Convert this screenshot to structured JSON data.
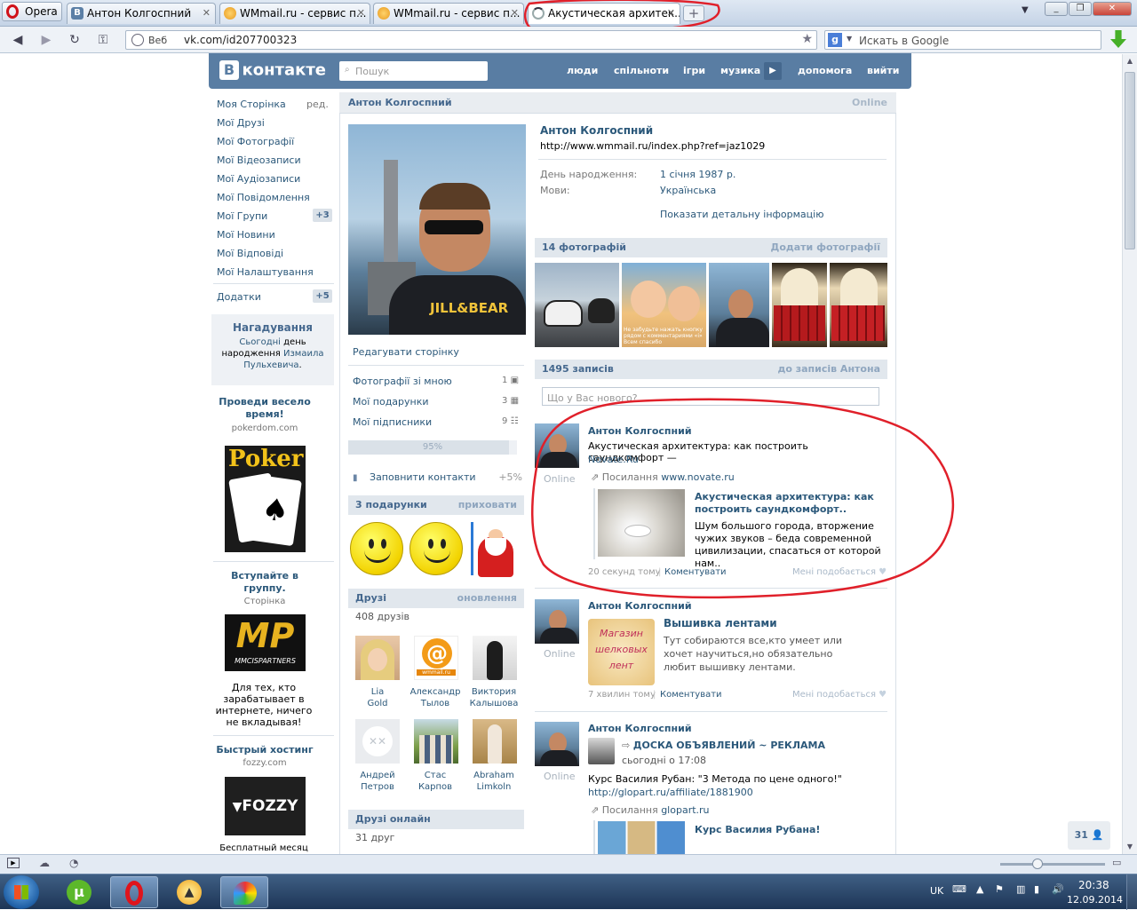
{
  "browser": {
    "app_name": "Opera",
    "tabs": [
      {
        "label": "Антон Колгоспний"
      },
      {
        "label": "WMmail.ru - сервис п..."
      },
      {
        "label": "WMmail.ru - сервис п..."
      },
      {
        "label": "Акустическая архитек..."
      }
    ],
    "address": {
      "prefix": "Веб",
      "url": "vk.com/id207700323"
    },
    "search_placeholder": "Искать в Google"
  },
  "vk": {
    "logo": "контакте",
    "logo_b": "В",
    "search_placeholder": "Пошук",
    "menu": [
      "люди",
      "спільноти",
      "ігри",
      "музика",
      "допомога",
      "вийти"
    ],
    "left_menu": [
      {
        "label": "Моя Сторінка",
        "extra": "ред."
      },
      {
        "label": "Мої Друзі"
      },
      {
        "label": "Мої Фотографії"
      },
      {
        "label": "Мої Відеозаписи"
      },
      {
        "label": "Мої Аудіозаписи"
      },
      {
        "label": "Мої Повідомлення"
      },
      {
        "label": "Мої Групи",
        "count": "+3"
      },
      {
        "label": "Мої Новини"
      },
      {
        "label": "Мої Відповіді"
      },
      {
        "label": "Мої Налаштування"
      },
      {
        "label": "Додатки",
        "count": "+5"
      }
    ],
    "reminder": {
      "title": "Нагадування",
      "line1a": "Сьогодні",
      "line1b": " день",
      "line2a": "народження ",
      "line2b": "Измаила",
      "line3": "Пульхевича",
      "line3end": "."
    },
    "ads": [
      {
        "title": "Проведи весело время!",
        "domain": "pokerdom.com",
        "img_text": "Poker"
      },
      {
        "title": "Вступайте в группу.",
        "domain": "Сторінка",
        "img_text": "MP",
        "img_sub": "MMCISPARTNERS",
        "desc": "Для тех, кто зарабатывает в интернете, ничего не вкладывая!"
      },
      {
        "title": "Быстрый хостинг",
        "domain": "fozzy.com",
        "img_text": "FOZZY",
        "desc": "Бесплатный месяц"
      }
    ],
    "profile": {
      "header_name": "Антон Колгоспний",
      "header_status": "Online",
      "name": "Антон Колгоспний",
      "status_text": "http://www.wmmail.ru/index.php?ref=jaz1029",
      "birthday_label": "День народження:",
      "birthday_value": "1 січня 1987 р.",
      "lang_label": "Мови:",
      "lang_value": "Українська",
      "more_info": "Показати детальну інформацію",
      "photo_shirt": "JILL&BEAR"
    },
    "mid": {
      "edit_page": "Редагувати сторінку",
      "links": [
        {
          "label": "Фотографії зі мною",
          "count": "1"
        },
        {
          "label": "Мої подарунки",
          "count": "3"
        },
        {
          "label": "Мої підписники",
          "count": "9"
        }
      ],
      "progress_label": "95%",
      "progress": 0.95,
      "fill_contacts": "Заповнити контакти",
      "fill_bonus": "+5%",
      "gifts_header": "3 подарунки",
      "gifts_hide": "приховати",
      "friends_header": "Друзі",
      "friends_update": "оновлення",
      "friends_count": "408 друзів",
      "friends": [
        {
          "first": "Lia",
          "last": "Gold"
        },
        {
          "first": "Александр",
          "last": "Тылов",
          "img_text": "wmmail.ru"
        },
        {
          "first": "Виктория",
          "last": "Калышова"
        },
        {
          "first": "Андрей",
          "last": "Петров"
        },
        {
          "first": "Стас",
          "last": "Карпов"
        },
        {
          "first": "Abraham",
          "last": "Limkoln"
        }
      ],
      "online_header": "Друзі онлайн",
      "online_count": "31 друг"
    },
    "photos": {
      "header": "14 фотографій",
      "add": "Додати фотографії",
      "photo2_caption": "Не забудьте нажать кнопку рядом с комментариями «i» Всем спасибо"
    },
    "wall": {
      "header": "1495 записів",
      "to_posts": "до записів Антона",
      "input_placeholder": "Що у Вас нового?",
      "posts": [
        {
          "author": "Антон Колгоспний",
          "online": "Online",
          "text": "Акустическая архитектура: как построить саундкомфорт —",
          "text_link": "Novate.Ru",
          "link_label": "Посилання",
          "link_url": "www.novate.ru",
          "card_title": "Акустическая архитектура: как построить саундкомфорт..",
          "card_desc": "Шум большого города, вторжение чужих звуков – беда современной цивилизации, спасаться от которой нам..",
          "time": "20 секунд тому",
          "comment": "Коментувати",
          "like": "Мені подобається"
        },
        {
          "author": "Антон Колгоспний",
          "online": "Online",
          "img_text": "Магазин шелковых лент",
          "title": "Вышивка лентами",
          "text": "Тут собираются все,кто умеет или хочет научиться,но обязательно любит вышивку лентами.",
          "time": "7 хвилин тому",
          "comment": "Коментувати",
          "like": "Мені подобається"
        },
        {
          "author": "Антон Колгоспний",
          "online": "Online",
          "repost_title": "ДОСКА ОБЪЯВЛЕНИЙ ~ РЕКЛАМА",
          "repost_time": "сьогодні о 17:08",
          "text": "Курс Василия Рубан: \"3 Метода по цене одного!\"",
          "text_link": "http://glopart.ru/affiliate/1881900",
          "link_label": "Посилання",
          "link_url": "glopart.ru",
          "card_title": "Курс Василия Рубана!"
        }
      ]
    },
    "online_badge": "31"
  },
  "system": {
    "lang": "UK",
    "time": "20:38",
    "date": "12.09.2014"
  },
  "colors": {
    "vk_blue": "#597da3",
    "vk_link": "#2b587a",
    "annotation_red": "#e0202a"
  }
}
